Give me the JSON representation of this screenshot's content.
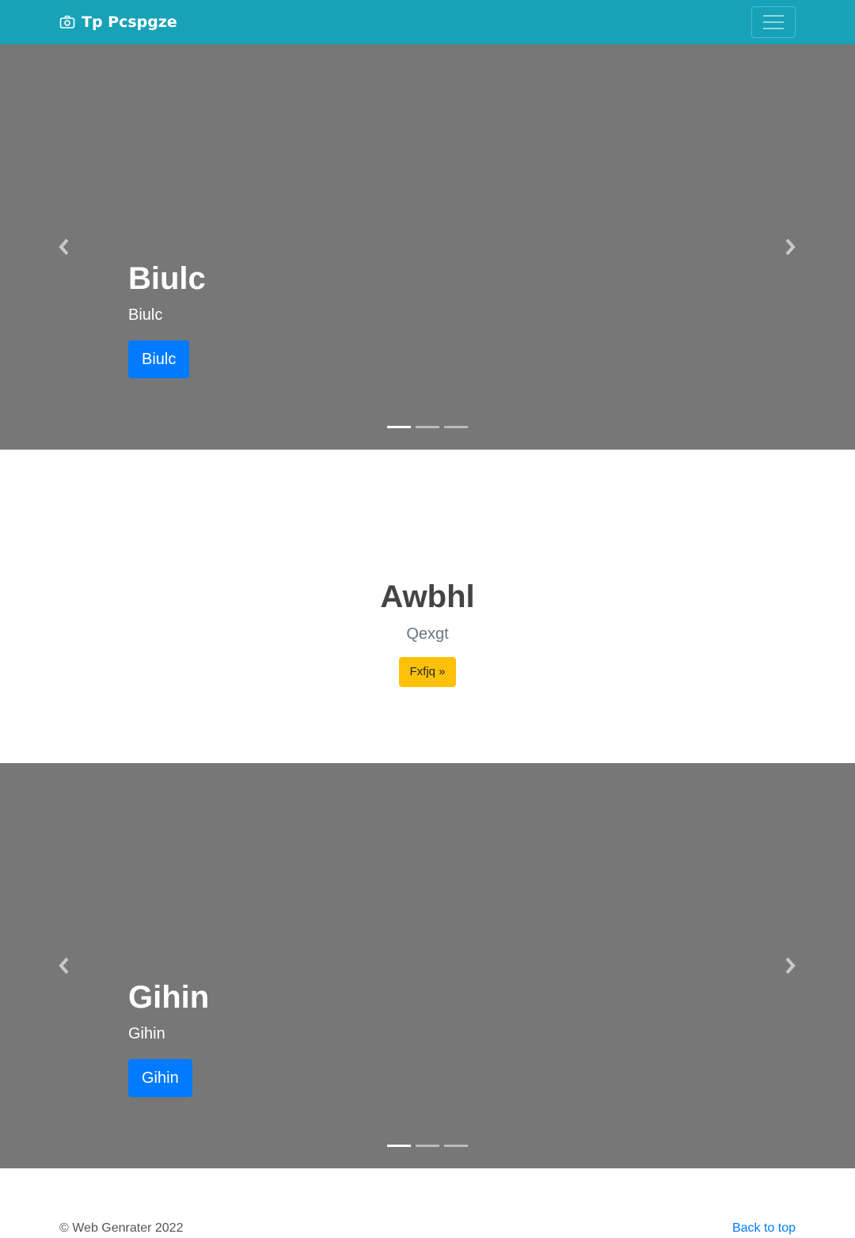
{
  "navbar": {
    "brand": "Tp Pcspgze",
    "brand_icon": "camera-icon",
    "toggler_icon": "hamburger-menu-icon",
    "background": "#17a2b8"
  },
  "carousel_top": {
    "title": "Biulc",
    "text": "Biulc",
    "button": "Biulc",
    "prev_icon": "chevron-left-icon",
    "next_icon": "chevron-right-icon",
    "slides": 3,
    "active_slide": 1
  },
  "hero": {
    "title": "Awbhl",
    "lead": "Qexgt",
    "button": "Fxfjq »",
    "button_color": "#ffc107"
  },
  "carousel_bottom": {
    "title": "Gihin",
    "text": "Gihin",
    "button": "Gihin",
    "prev_icon": "chevron-left-icon",
    "next_icon": "chevron-right-icon",
    "slides": 3,
    "active_slide": 1
  },
  "footer": {
    "copyright": "© Web Genrater 2022",
    "back_to_top": "Back to top"
  },
  "colors": {
    "carousel_bg": "#777777",
    "primary": "#007bff"
  }
}
